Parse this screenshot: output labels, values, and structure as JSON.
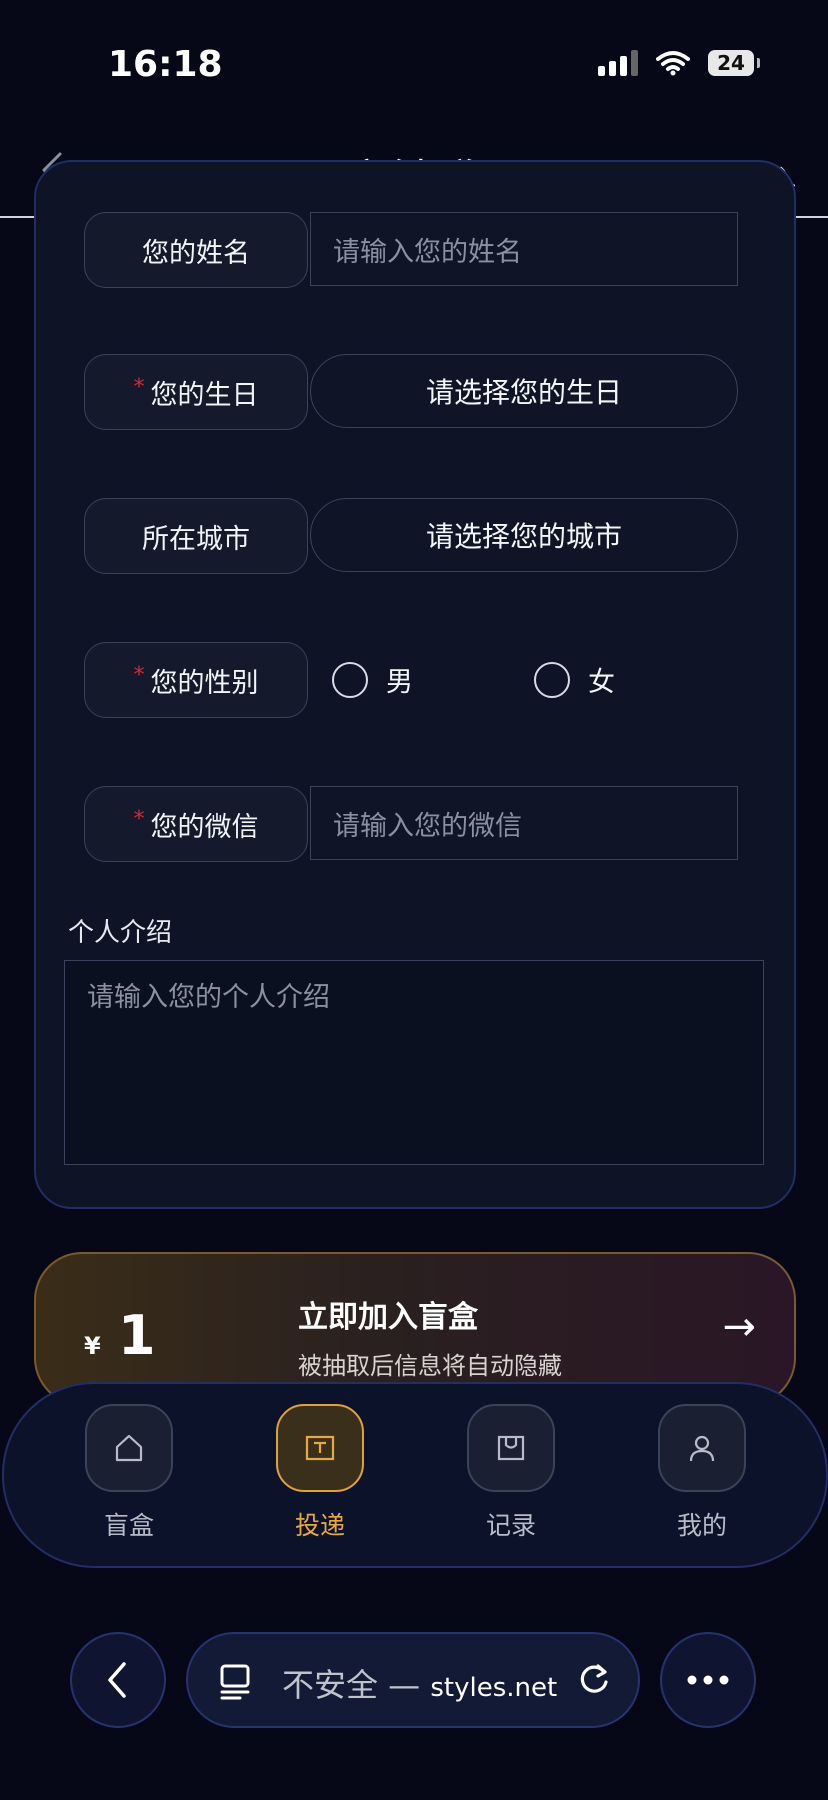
{
  "status_bar": {
    "time": "16:18",
    "battery": "24"
  },
  "nav": {
    "title": "盲盒投递",
    "right_action": "自动填入"
  },
  "form": {
    "name": {
      "label": "您的姓名",
      "placeholder": "请输入您的姓名"
    },
    "birthday": {
      "required_mark": "*",
      "label": "您的生日",
      "value": "请选择您的生日"
    },
    "city": {
      "label": "所在城市",
      "value": "请选择您的城市"
    },
    "gender": {
      "required_mark": "*",
      "label": "您的性别",
      "options": [
        "男",
        "女"
      ]
    },
    "wechat": {
      "required_mark": "*",
      "label": "您的微信",
      "placeholder": "请输入您的微信"
    },
    "intro": {
      "label": "个人介绍",
      "placeholder": "请输入您的个人介绍"
    }
  },
  "promo": {
    "currency": "¥",
    "price": "1",
    "title": "立即加入盲盒",
    "subtitle": "被抽取后信息将自动隐藏",
    "arrow": "→"
  },
  "tabbar": {
    "items": [
      {
        "label": "盲盒",
        "icon": "home-icon"
      },
      {
        "label": "投递",
        "icon": "mailbox-icon",
        "active": true
      },
      {
        "label": "记录",
        "icon": "bag-icon"
      },
      {
        "label": "我的",
        "icon": "user-icon"
      }
    ]
  },
  "browser": {
    "url_prefix": "不安全 — ",
    "url_domain": "styles.net"
  },
  "colors": {
    "accent": "#e7a93a",
    "required": "#e0243a",
    "background": "#060818"
  }
}
